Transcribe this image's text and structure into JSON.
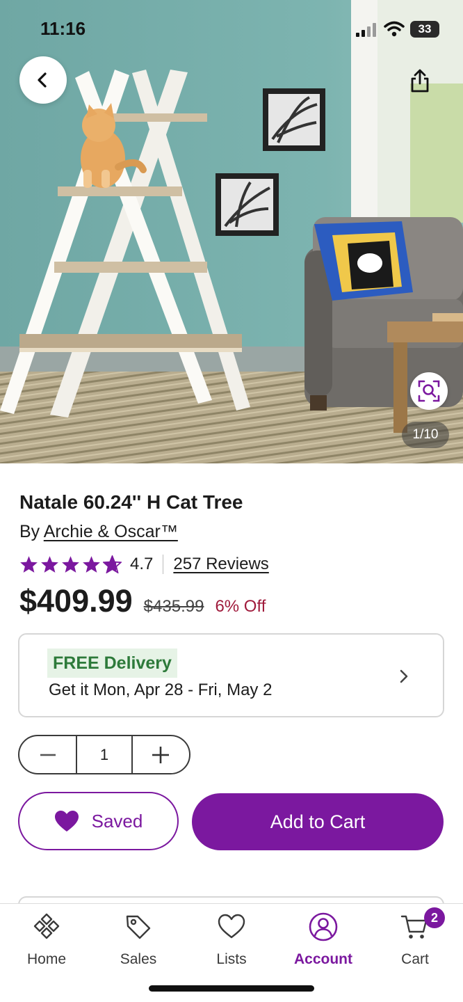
{
  "status_bar": {
    "time": "11:16",
    "battery": "33"
  },
  "gallery": {
    "counter": "1/10"
  },
  "product": {
    "title": "Natale 60.24'' H Cat Tree",
    "by_prefix": "By ",
    "brand": "Archie & Oscar™",
    "rating": "4.7",
    "rating_stars": 4.7,
    "reviews": "257 Reviews",
    "price": "$409.99",
    "was_price": "$435.99",
    "discount": "6% Off"
  },
  "delivery": {
    "badge": "FREE Delivery",
    "dates": "Get it Mon, Apr 28 - Fri, May 2"
  },
  "quantity": {
    "value": "1"
  },
  "actions": {
    "saved_label": "Saved",
    "add_to_cart_label": "Add to Cart"
  },
  "bottom_nav": {
    "items": [
      {
        "label": "Home",
        "icon": "home-icon"
      },
      {
        "label": "Sales",
        "icon": "tag-icon"
      },
      {
        "label": "Lists",
        "icon": "heart-icon"
      },
      {
        "label": "Account",
        "icon": "account-icon",
        "active": true
      },
      {
        "label": "Cart",
        "icon": "cart-icon"
      }
    ],
    "cart_count": "2"
  },
  "colors": {
    "brand_purple": "#7b189f",
    "discount_red": "#a01b3c",
    "free_green": "#2d7a3a",
    "star_purple": "#7b189f"
  }
}
